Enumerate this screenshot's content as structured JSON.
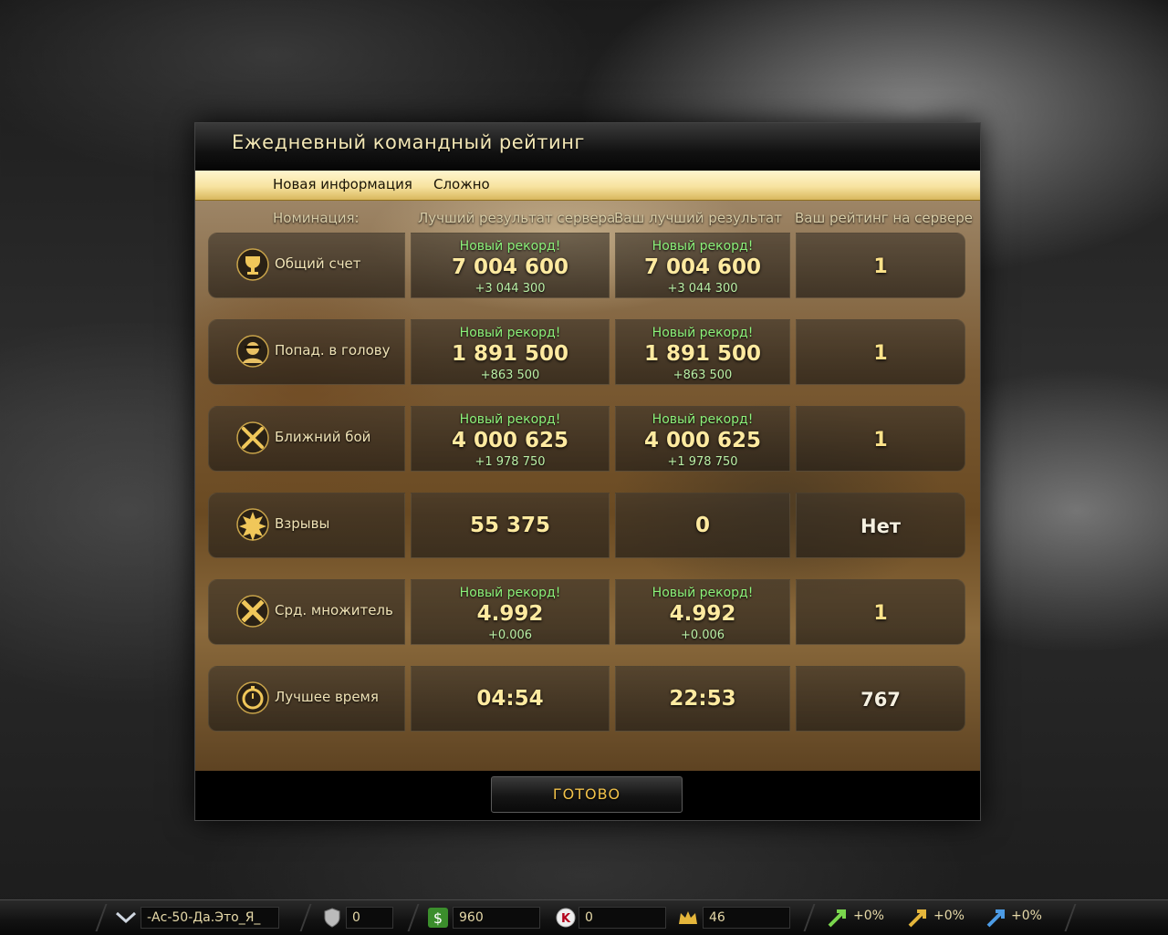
{
  "dialog": {
    "title": "Ежедневный командный рейтинг",
    "info_label": "Новая информация",
    "difficulty": "Сложно",
    "done_label": "ГОТОВО"
  },
  "columns": {
    "nomination": "Номинация:",
    "server_best": "Лучший результат сервера",
    "your_best": "Ваш лучший результат",
    "your_rank": "Ваш рейтинг на сервере"
  },
  "rows": [
    {
      "icon": "trophy-icon",
      "name": "Общий счет",
      "server": {
        "record": "Новый рекорд!",
        "value": "7 004 600",
        "delta": "+3 044 300"
      },
      "best": {
        "record": "Новый рекорд!",
        "value": "7 004 600",
        "delta": "+3 044 300"
      },
      "rank": "1"
    },
    {
      "icon": "headshot-icon",
      "name": "Попад. в голову",
      "server": {
        "record": "Новый рекорд!",
        "value": "1 891 500",
        "delta": "+863 500"
      },
      "best": {
        "record": "Новый рекорд!",
        "value": "1 891 500",
        "delta": "+863 500"
      },
      "rank": "1"
    },
    {
      "icon": "melee-icon",
      "name": "Ближний бой",
      "server": {
        "record": "Новый рекорд!",
        "value": "4 000 625",
        "delta": "+1 978 750"
      },
      "best": {
        "record": "Новый рекорд!",
        "value": "4 000 625",
        "delta": "+1 978 750"
      },
      "rank": "1"
    },
    {
      "icon": "explosion-icon",
      "name": "Взрывы",
      "server": {
        "value": "55 375"
      },
      "best": {
        "value": "0"
      },
      "rank": "Нет"
    },
    {
      "icon": "multiplier-icon",
      "name": "Срд. множитель",
      "server": {
        "record": "Новый рекорд!",
        "value": "4.992",
        "delta": "+0.006"
      },
      "best": {
        "record": "Новый рекорд!",
        "value": "4.992",
        "delta": "+0.006"
      },
      "rank": "1"
    },
    {
      "icon": "stopwatch-icon",
      "name": "Лучшее время",
      "server": {
        "value": "04:54"
      },
      "best": {
        "value": "22:53"
      },
      "rank": "767"
    }
  ],
  "statusbar": {
    "rank_icon": "chevron-rank-icon",
    "player_name": "-Ас-50-Да.Это_Я_",
    "shield_value": "0",
    "money": "960",
    "k_value": "0",
    "crown_value": "46",
    "boost_xp": "+0%",
    "boost_money": "+0%",
    "boost_k": "+0%"
  }
}
